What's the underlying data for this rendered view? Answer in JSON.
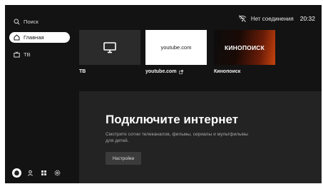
{
  "status": {
    "connection": "Нет соединения",
    "time": "20:32"
  },
  "sidebar": {
    "items": [
      {
        "label": "Поиск",
        "icon": "search-icon"
      },
      {
        "label": "Главная",
        "icon": "home-icon",
        "active": true
      },
      {
        "label": "ТВ",
        "icon": "tv-icon"
      }
    ],
    "bottom_icons": [
      "alice-icon",
      "profile-icon",
      "apps-icon",
      "settings-icon"
    ]
  },
  "cards": [
    {
      "label": "ТВ",
      "icon": "monitor-icon"
    },
    {
      "label": "youtube.com",
      "preview_text": "youtube.com",
      "external": true
    },
    {
      "label": "Кинопоиск",
      "logo_text": "КИНОПОИСК"
    }
  ],
  "hero": {
    "title": "Подключите интернет",
    "description": "Смотрите сотни телеканалов, фильмы, сериалы и мультфильмы для детей.",
    "button_label": "Настройки"
  },
  "colors": {
    "background": "#131313",
    "card_bg": "#2b2b2b",
    "hero_bg": "#232323",
    "accent_orange": "#c8430e"
  }
}
